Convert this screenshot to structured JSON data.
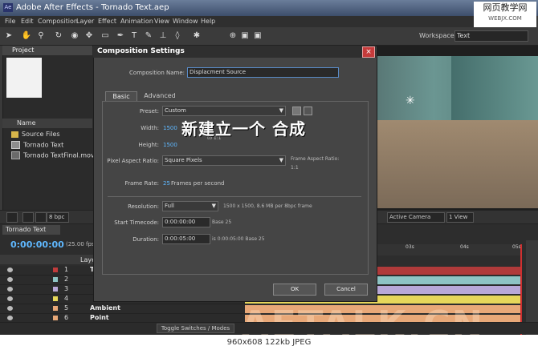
{
  "window": {
    "title": "Adobe After Effects - Tornado Text.aep"
  },
  "app_icon": "Ae",
  "watermark": {
    "line1": "网页教学网",
    "line2": "WEBJX.COM"
  },
  "menu": [
    "File",
    "Edit",
    "Composition",
    "Layer",
    "Effect",
    "Animation",
    "View",
    "Window",
    "Help"
  ],
  "workspace": {
    "label": "Workspace:",
    "value": "Text"
  },
  "project": {
    "tab": "Project",
    "name_header": "Name",
    "items": [
      {
        "name": "Source Files",
        "icon": "folder-icon"
      },
      {
        "name": "Tornado Text",
        "icon": "composition-icon"
      },
      {
        "name": "Tornado TextFinal.mov",
        "icon": "footage-icon"
      }
    ]
  },
  "viewer": {
    "bpc": "8 bpc",
    "camera": "Active Camera",
    "view": "1 View"
  },
  "timeline": {
    "tab": "Tornado Text",
    "timecode": "0:00:00:00",
    "fps": "(25.00 fps)",
    "layer_header": "Laye",
    "ruler": [
      "03s",
      "04s",
      "05s"
    ],
    "toggle_label": "Toggle Switches / Modes",
    "layers": [
      {
        "num": "1",
        "name": "T",
        "color": "#c03c3c",
        "track": "#b03a3a"
      },
      {
        "num": "2",
        "name": "",
        "color": "#8ec4c4",
        "track": "#8ec4c4"
      },
      {
        "num": "3",
        "name": "",
        "color": "#b8a8d8",
        "track": "#b8a8d8"
      },
      {
        "num": "4",
        "name": "",
        "color": "#e6d65a",
        "track": "#e6d65a"
      },
      {
        "num": "5",
        "name": "Ambient",
        "color": "#e8a878",
        "track": "#e8a878"
      },
      {
        "num": "6",
        "name": "Point",
        "color": "#e8a878",
        "track": "#e8a878"
      }
    ]
  },
  "dialog": {
    "title": "Composition Settings",
    "comp_name_label": "Composition Name:",
    "comp_name": "Displacment Source",
    "tabs": [
      "Basic",
      "Advanced"
    ],
    "preset_label": "Preset:",
    "preset": "Custom",
    "width_label": "Width:",
    "width": "1500",
    "height_label": "Height:",
    "height": "1500",
    "aspect_note": "to 1:1",
    "par_label": "Pixel Aspect Ratio:",
    "par": "Square Pixels",
    "frame_aspect_label": "Frame Aspect Ratio:",
    "frame_aspect": "1:1",
    "frame_rate_label": "Frame Rate:",
    "frame_rate": "25",
    "frame_rate_unit": "Frames per second",
    "resolution_label": "Resolution:",
    "resolution": "Full",
    "resolution_note": "1500 x 1500, 8.6 MB per 8bpc frame",
    "start_tc_label": "Start Timecode:",
    "start_tc": "0:00:00:00",
    "start_tc_note": "Base 25",
    "duration_label": "Duration:",
    "duration": "0:00:05:00",
    "duration_note": "is 0:00:05:00  Base 25",
    "ok": "OK",
    "cancel": "Cancel",
    "close": "×"
  },
  "overlay_text": "新建立一个  合成",
  "aetalk": "AETALK.CN",
  "status": "960x608  122kb  JPEG"
}
